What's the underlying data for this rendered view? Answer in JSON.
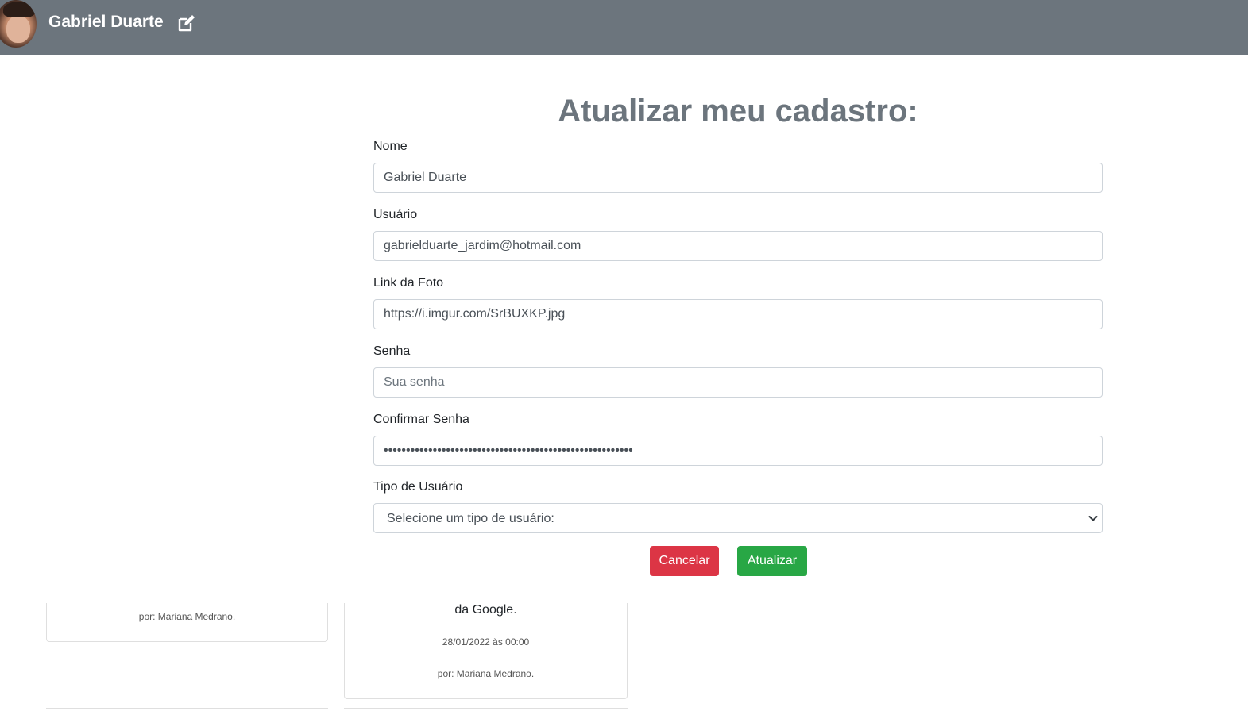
{
  "header": {
    "username": "Gabriel Duarte",
    "avatar_icon": "user-photo",
    "edit_icon": "edit-icon"
  },
  "form": {
    "title": "Atualizar meu cadastro:",
    "fields": {
      "nome": {
        "label": "Nome",
        "value": "Gabriel Duarte"
      },
      "usuario": {
        "label": "Usuário",
        "value": "gabrielduarte_jardim@hotmail.com"
      },
      "foto": {
        "label": "Link da Foto",
        "value": "https://i.imgur.com/SrBUXKP.jpg"
      },
      "senha": {
        "label": "Senha",
        "value": "",
        "placeholder": "Sua senha"
      },
      "confirmar": {
        "label": "Confirmar Senha",
        "value": "••••••••••••••••••••••••••••••••••••••••••••••••••••••••"
      },
      "tipo": {
        "label": "Tipo de Usuário",
        "selected": "Selecione um tipo de usuário:"
      }
    },
    "buttons": {
      "cancel": "Cancelar",
      "update": "Atualizar"
    }
  },
  "cards": [
    {
      "author": "por: Mariana Medrano."
    },
    {
      "snippet": "da Google.",
      "date": "28/01/2022 às 00:00",
      "author": "por: Mariana Medrano."
    }
  ],
  "colors": {
    "header_bg": "#6c757d",
    "title": "#6c757d",
    "cancel": "#dc3545",
    "update": "#28a745"
  }
}
